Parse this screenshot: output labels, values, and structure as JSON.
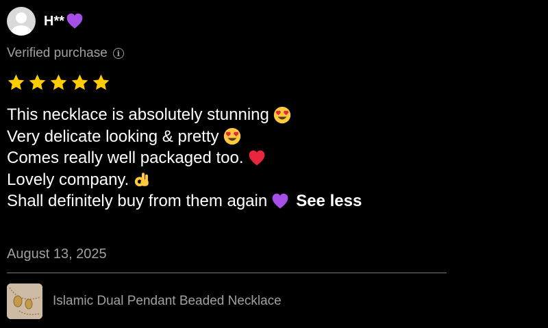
{
  "reviewer": {
    "name": "H**",
    "badge_icon": "purple-heart-icon"
  },
  "verified": {
    "label": "Verified purchase",
    "icon": "info-icon"
  },
  "rating": {
    "stars": 5,
    "max": 5,
    "color": "#FFCC00"
  },
  "review": {
    "lines": [
      "This necklace is absolutely stunning",
      "Very delicate looking & pretty",
      "Comes really well packaged too.",
      "Lovely company.",
      "Shall definitely buy from them again"
    ],
    "line_emojis": [
      "heart-eyes-emoji",
      "heart-eyes-emoji",
      "red-heart-emoji",
      "ok-hand-emoji",
      "purple-heart-emoji"
    ],
    "toggle_label": "See less"
  },
  "date": "August 13, 2025",
  "product": {
    "name": "Islamic Dual Pendant Beaded Necklace",
    "thumbnail": "necklace-thumbnail"
  }
}
